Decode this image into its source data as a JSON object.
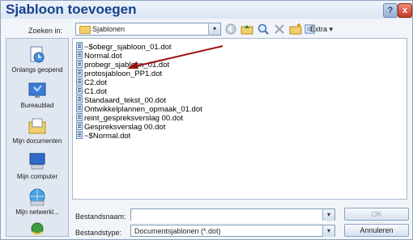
{
  "window": {
    "title": "Sjabloon toevoegen",
    "help_glyph": "?",
    "close_glyph": "x"
  },
  "lookin": {
    "label": "Zoeken in:",
    "value": "Sjablonen"
  },
  "toolbar": {
    "extra_label": "Extra",
    "dropdown_glyph": "▾"
  },
  "places": [
    {
      "label": "Onlangs geopend",
      "icon": "recent-documents-icon"
    },
    {
      "label": "Bureaublad",
      "icon": "desktop-icon"
    },
    {
      "label": "Mijn documenten",
      "icon": "my-documents-icon"
    },
    {
      "label": "Mijn computer",
      "icon": "my-computer-icon"
    },
    {
      "label": "Mijn netwerkl...",
      "icon": "network-places-icon"
    }
  ],
  "files": [
    "~$obegr_sjabloon_01.dot",
    "Normal.dot",
    "probegr_sjabloon_01.dot",
    "protosjabloon_PP1.dot",
    "C2.dot",
    "C1.dot",
    "Standaard_tekst_00.dot",
    "Ontwikkelplannen_opmaak_01.dot",
    "reint_gespreksverslag 00.dot",
    "Gespreksverslag 00.dot",
    "~$Normal.dot"
  ],
  "filename": {
    "label": "Bestandsnaam:",
    "value": ""
  },
  "filetype": {
    "label": "Bestandstype:",
    "value": "Documentsjablonen (*.dot)"
  },
  "buttons": {
    "ok": "OK",
    "cancel": "Annuleren"
  },
  "colors": {
    "title": "#15428b",
    "annotation_arrow": "#9a1010"
  }
}
